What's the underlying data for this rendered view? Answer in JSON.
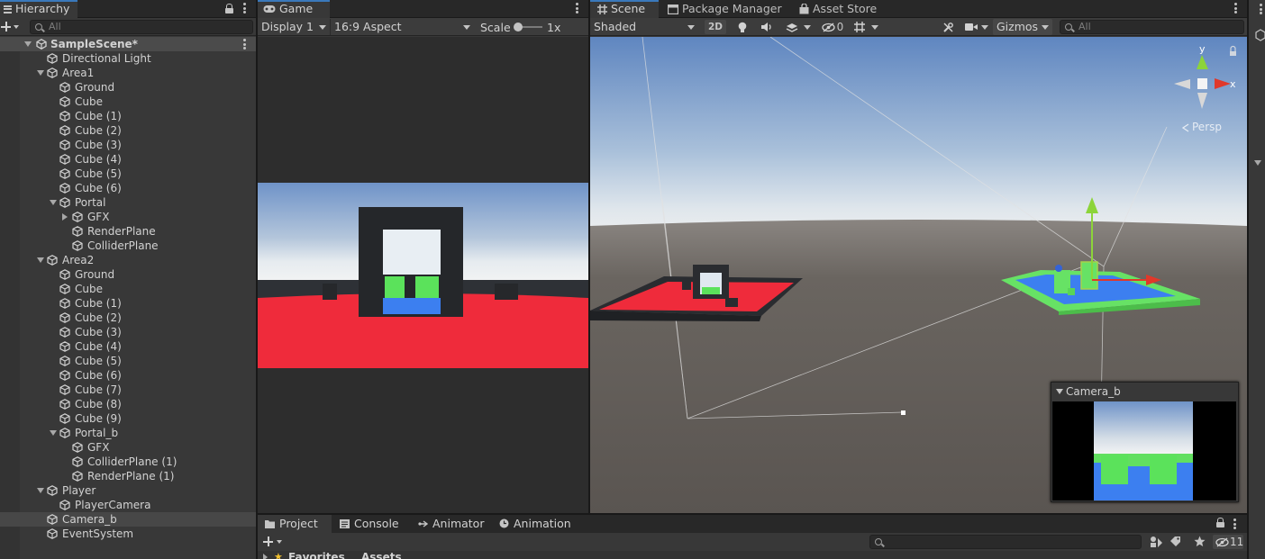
{
  "hierarchy": {
    "tab_label": "Hierarchy",
    "search_placeholder": "All",
    "scene_name": "SampleScene*",
    "items": [
      {
        "label": "Directional Light",
        "depth": 1,
        "fold": "none"
      },
      {
        "label": "Area1",
        "depth": 1,
        "fold": "open"
      },
      {
        "label": "Ground",
        "depth": 2,
        "fold": "none"
      },
      {
        "label": "Cube",
        "depth": 2,
        "fold": "none"
      },
      {
        "label": "Cube (1)",
        "depth": 2,
        "fold": "none"
      },
      {
        "label": "Cube (2)",
        "depth": 2,
        "fold": "none"
      },
      {
        "label": "Cube (3)",
        "depth": 2,
        "fold": "none"
      },
      {
        "label": "Cube (4)",
        "depth": 2,
        "fold": "none"
      },
      {
        "label": "Cube (5)",
        "depth": 2,
        "fold": "none"
      },
      {
        "label": "Cube (6)",
        "depth": 2,
        "fold": "none"
      },
      {
        "label": "Portal",
        "depth": 2,
        "fold": "open"
      },
      {
        "label": "GFX",
        "depth": 3,
        "fold": "closed"
      },
      {
        "label": "RenderPlane",
        "depth": 3,
        "fold": "none"
      },
      {
        "label": "ColliderPlane",
        "depth": 3,
        "fold": "none"
      },
      {
        "label": "Area2",
        "depth": 1,
        "fold": "open"
      },
      {
        "label": "Ground",
        "depth": 2,
        "fold": "none"
      },
      {
        "label": "Cube",
        "depth": 2,
        "fold": "none"
      },
      {
        "label": "Cube (1)",
        "depth": 2,
        "fold": "none"
      },
      {
        "label": "Cube (2)",
        "depth": 2,
        "fold": "none"
      },
      {
        "label": "Cube (3)",
        "depth": 2,
        "fold": "none"
      },
      {
        "label": "Cube (4)",
        "depth": 2,
        "fold": "none"
      },
      {
        "label": "Cube (5)",
        "depth": 2,
        "fold": "none"
      },
      {
        "label": "Cube (6)",
        "depth": 2,
        "fold": "none"
      },
      {
        "label": "Cube (7)",
        "depth": 2,
        "fold": "none"
      },
      {
        "label": "Cube (8)",
        "depth": 2,
        "fold": "none"
      },
      {
        "label": "Cube (9)",
        "depth": 2,
        "fold": "none"
      },
      {
        "label": "Portal_b",
        "depth": 2,
        "fold": "open"
      },
      {
        "label": "GFX",
        "depth": 3,
        "fold": "none"
      },
      {
        "label": "ColliderPlane (1)",
        "depth": 3,
        "fold": "none"
      },
      {
        "label": "RenderPlane (1)",
        "depth": 3,
        "fold": "none"
      },
      {
        "label": "Player",
        "depth": 1,
        "fold": "open"
      },
      {
        "label": "PlayerCamera",
        "depth": 2,
        "fold": "none"
      },
      {
        "label": "Camera_b",
        "depth": 1,
        "fold": "none",
        "selected": true
      },
      {
        "label": "EventSystem",
        "depth": 1,
        "fold": "none"
      }
    ]
  },
  "game": {
    "tab_label": "Game",
    "display": "Display 1",
    "aspect": "16:9 Aspect",
    "scale_label": "Scale",
    "scale_value": "1x"
  },
  "scene": {
    "tabs": [
      "Scene",
      "Package Manager",
      "Asset Store"
    ],
    "shading": "Shaded",
    "mode_2d": "2D",
    "hidden_count": "0",
    "gizmos": "Gizmos",
    "search_placeholder": "All",
    "gizmo_y": "y",
    "gizmo_x": "x",
    "persp": "Persp",
    "camera_preview_title": "Camera_b"
  },
  "bottom": {
    "tabs": [
      "Project",
      "Console",
      "Animator",
      "Animation"
    ],
    "favorites": "Favorites",
    "assets": "Assets",
    "hidden_count": "11"
  },
  "colors": {
    "accent": "#3a79bb",
    "red_floor": "#ef2b3b",
    "green_cube": "#5be25b",
    "blue_floor": "#3c7ff0",
    "gizmo_green": "#8cd43a",
    "gizmo_red": "#e0382a"
  }
}
